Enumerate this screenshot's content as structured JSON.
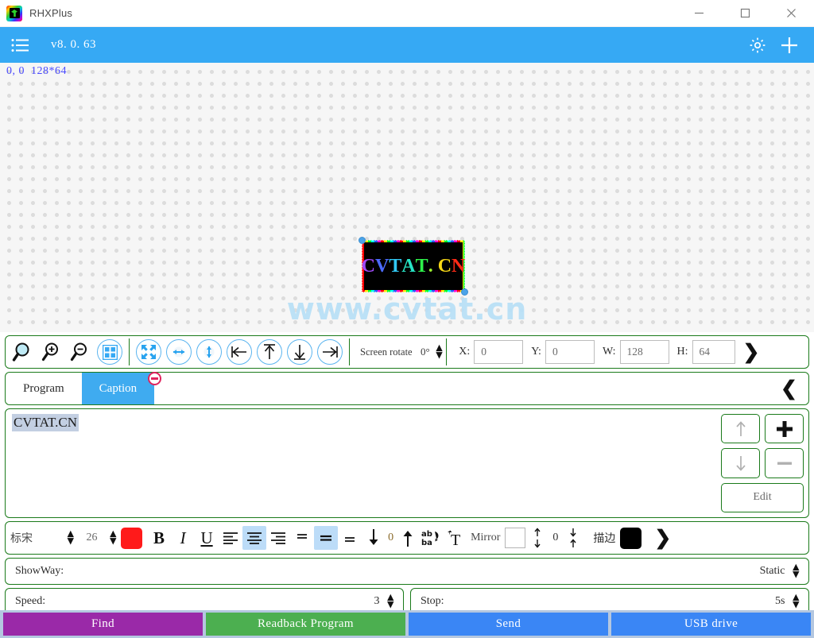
{
  "window": {
    "title": "RHXPlus",
    "minimize_label": "—",
    "maximize_label": "☐",
    "close_label": "✕"
  },
  "header": {
    "version": "v8. 0. 63",
    "menu_icon": "hamburger-icon",
    "settings_icon": "gear-icon",
    "add_icon": "plus-icon"
  },
  "canvas": {
    "coord_label": "0, 0  128*64",
    "watermark": "www.cvtat.cn",
    "led": {
      "text": "CVTAT.CN",
      "letters": [
        "C",
        "V",
        "T",
        "A",
        "T",
        ".",
        " ",
        "C",
        "N"
      ],
      "letter_colors": [
        "#a24bff",
        "#4b6bff",
        "#31c9f5",
        "#27e3c4",
        "#2ef24a",
        "#9cf22e",
        "#000000",
        "#f5d616",
        "#ff2a16"
      ],
      "background": "#000000",
      "width": 128,
      "height": 64
    }
  },
  "view_toolbar": {
    "icons": [
      {
        "name": "zoom-fit-icon",
        "style": "plain"
      },
      {
        "name": "zoom-in-icon",
        "style": "plain"
      },
      {
        "name": "zoom-out-icon",
        "style": "plain"
      },
      {
        "name": "grid-icon",
        "style": "circle"
      },
      {
        "name": "fit-screen-icon",
        "style": "circle"
      },
      {
        "name": "stretch-horizontal-icon",
        "style": "circle"
      },
      {
        "name": "stretch-vertical-icon",
        "style": "circle"
      },
      {
        "name": "align-left-edge-icon",
        "style": "circle"
      },
      {
        "name": "align-top-edge-icon",
        "style": "circle"
      },
      {
        "name": "align-bottom-edge-icon",
        "style": "circle"
      },
      {
        "name": "align-right-edge-icon",
        "style": "circle"
      }
    ],
    "screen_rotate_label": "Screen rotate",
    "screen_rotate_value": "0°",
    "x_label": "X:",
    "x_value": "0",
    "y_label": "Y:",
    "y_value": "0",
    "w_label": "W:",
    "w_value": "128",
    "h_label": "H:",
    "h_value": "64",
    "expand_icon": "chevron-right-icon"
  },
  "tabs": {
    "items": [
      {
        "label": "Program",
        "active": false
      },
      {
        "label": "Caption",
        "active": true
      }
    ],
    "badge_icon": "remove-circle-icon",
    "collapse_icon": "chevron-left-icon"
  },
  "text_list": {
    "items": [
      {
        "text": "CVTAT.CN",
        "selected": true
      }
    ],
    "buttons": [
      {
        "name": "move-up-button",
        "icon": "arrow-up-icon"
      },
      {
        "name": "add-button",
        "icon": "plus-icon"
      },
      {
        "name": "move-down-button",
        "icon": "arrow-down-icon"
      },
      {
        "name": "remove-button",
        "icon": "minus-icon"
      },
      {
        "name": "edit-button",
        "label": "Edit"
      }
    ],
    "edit_label": "Edit"
  },
  "format_toolbar": {
    "font_name": "标宋",
    "font_size": "26",
    "font_color": "#ff1a1a",
    "bold_label": "B",
    "italic_label": "I",
    "underline_label": "U",
    "align_buttons": [
      {
        "name": "align-left-button",
        "active": false
      },
      {
        "name": "align-center-button",
        "active": true
      },
      {
        "name": "align-right-button",
        "active": false
      }
    ],
    "valign_buttons": [
      {
        "name": "valign-top-button",
        "active": false
      },
      {
        "name": "valign-middle-button",
        "active": true
      },
      {
        "name": "valign-bottom-button",
        "active": false
      }
    ],
    "line_spacing_down_icon": "arrow-down-icon",
    "line_spacing_value": "0",
    "line_spacing_up_icon": "arrow-up-icon",
    "flip_icon": "flip-text-icon",
    "text_rotate_icon": "rotate-text-icon",
    "mirror_label": "Mirror",
    "mirror_checked": false,
    "char_spacing_value": "0",
    "stroke_label": "描边",
    "stroke_color": "#000000",
    "expand_icon": "chevron-right-icon"
  },
  "showway": {
    "label": "ShowWay:",
    "value": "Static",
    "spinner_icon": "spinner-icon"
  },
  "speed": {
    "label": "Speed:",
    "value": "3"
  },
  "stop": {
    "label": "Stop:",
    "value": "5s"
  },
  "actionbar": {
    "buttons": [
      {
        "label": "Find",
        "color": "#9a29a8"
      },
      {
        "label": "Readback Program",
        "color": "#4caf50"
      },
      {
        "label": "Send",
        "color": "#3a86f5"
      },
      {
        "label": "USB drive",
        "color": "#3a86f5"
      }
    ]
  }
}
